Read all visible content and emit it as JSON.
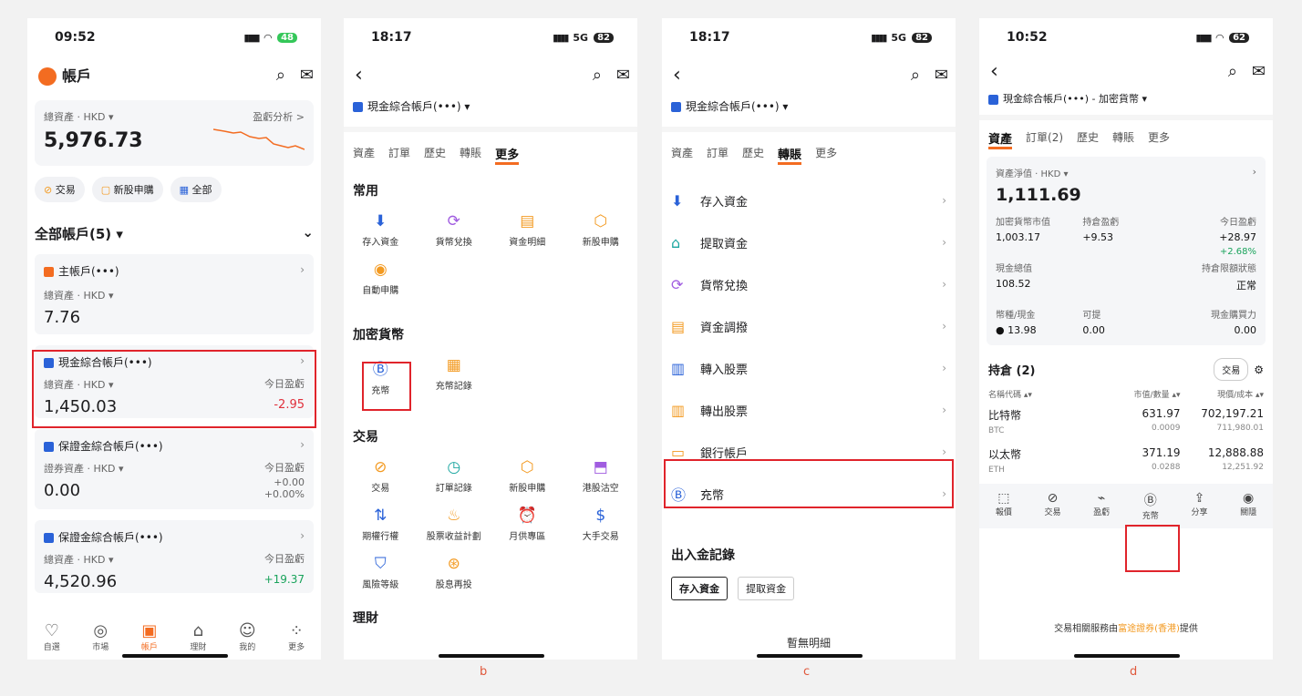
{
  "p1": {
    "time": "09:52",
    "battery": "48",
    "title": "帳戶",
    "total_label": "總資產 · HKD ▾",
    "pnl_link": "盈虧分析 >",
    "total_value": "5,976.73",
    "buttons": [
      "交易",
      "新股申購",
      "全部"
    ],
    "section": "全部帳戶(5) ▾",
    "cards": [
      {
        "name": "主帳戶(•••)",
        "label": "總資產 · HKD ▾",
        "value": "7.76",
        "pnl_label": "",
        "pnl": "",
        "pnl2": ""
      },
      {
        "name": "現金綜合帳戶(•••)",
        "label": "總資產 · HKD ▾",
        "value": "1,450.03",
        "pnl_label": "今日盈虧",
        "pnl": "-2.95",
        "pnl2": ""
      },
      {
        "name": "保證金綜合帳戶(•••)",
        "label": "證券資產 · HKD ▾",
        "value": "0.00",
        "pnl_label": "今日盈虧",
        "pnl": "+0.00",
        "pnl2": "+0.00%"
      },
      {
        "name": "保證金綜合帳戶(•••)",
        "label": "總資產 · HKD ▾",
        "value": "4,520.96",
        "pnl_label": "今日盈虧",
        "pnl": "+19.37",
        "pnl2": ""
      }
    ],
    "tabbar": [
      "自選",
      "市場",
      "帳戶",
      "理財",
      "我的",
      "更多"
    ]
  },
  "p2": {
    "time": "18:17",
    "network": "5G",
    "battery": "82",
    "account": "現金綜合帳戶(•••) ▾",
    "tabs": [
      "資產",
      "訂單",
      "歷史",
      "轉賬",
      "更多"
    ],
    "sections": [
      {
        "title": "常用",
        "items": [
          "存入資金",
          "貨幣兌換",
          "資金明細",
          "新股申購",
          "自動申購"
        ]
      },
      {
        "title": "加密貨幣",
        "items": [
          "充幣",
          "充幣記錄"
        ]
      },
      {
        "title": "交易",
        "items": [
          "交易",
          "訂單記錄",
          "新股申購",
          "港股沽空",
          "期權行權",
          "股票收益計劃",
          "月供專區",
          "大手交易",
          "風險等級",
          "股息再投"
        ]
      }
    ],
    "cut_section": "理財",
    "caption": "b"
  },
  "p3": {
    "time": "18:17",
    "network": "5G",
    "battery": "82",
    "account": "現金綜合帳戶(•••) ▾",
    "tabs": [
      "資產",
      "訂單",
      "歷史",
      "轉賬",
      "更多"
    ],
    "rows": [
      "存入資金",
      "提取資金",
      "貨幣兌換",
      "資金調撥",
      "轉入股票",
      "轉出股票",
      "銀行帳戶",
      "充幣"
    ],
    "records_title": "出入金記錄",
    "chips": [
      "存入資金",
      "提取資金"
    ],
    "empty": "暫無明細",
    "caption": "c"
  },
  "p4": {
    "time": "10:52",
    "battery": "62",
    "account": "現金綜合帳戶(•••) - 加密貨幣 ▾",
    "tabs": [
      "資產",
      "訂單(2)",
      "歷史",
      "轉賬",
      "更多"
    ],
    "net_label": "資產淨值 · HKD ▾",
    "net_value": "1,111.69",
    "m1_label": "加密貨幣市值",
    "m1": "1,003.17",
    "m2_label": "持倉盈虧",
    "m2": "+9.53",
    "m3_label": "今日盈虧",
    "m3": "+28.97",
    "m3b": "+2.68%",
    "m4_label": "現金總值",
    "m4": "108.52",
    "m5_label": "持倉限額狀態",
    "m5": "正常",
    "m6_label": "幣種/現金",
    "m6": "13.98",
    "m7_label": "可提",
    "m7": "0.00",
    "m8_label": "現金購買力",
    "m8": "0.00",
    "holdings_title": "持倉 (2)",
    "trade_chip": "交易",
    "cols": [
      "名稱代碼 ▴▾",
      "市值/數量 ▴▾",
      "現價/成本 ▴▾"
    ],
    "holdings": [
      {
        "name": "比特幣",
        "code": "BTC",
        "mv": "631.97",
        "qty": "0.0009",
        "price": "702,197.21",
        "cost": "711,980.01"
      },
      {
        "name": "以太幣",
        "code": "ETH",
        "mv": "371.19",
        "qty": "0.0288",
        "price": "12,888.88",
        "cost": "12,251.92"
      }
    ],
    "actions": [
      "報價",
      "交易",
      "盈虧",
      "充幣",
      "分享",
      "關隱"
    ],
    "footer_pre": "交易相關服務由",
    "footer_link": "富途證券(香港)",
    "footer_post": "提供",
    "caption": "d"
  },
  "colors": {
    "accent": "#f36c21",
    "highlight_box": "#e0242b",
    "negative": "#e0303c",
    "positive": "#19a35b"
  }
}
